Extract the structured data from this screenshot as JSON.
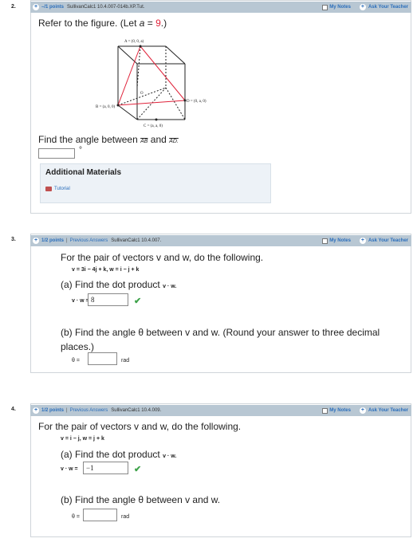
{
  "q2": {
    "num": "2.",
    "points": "–/1 points",
    "source": "SullivanCalc1 10.4.007-014b.XP.Tut.",
    "my_notes": "My Notes",
    "ask": "Ask Your Teacher",
    "intro_prefix": "Refer to the figure. (Let ",
    "intro_var": "a",
    "intro_eq": " = ",
    "intro_val": "9",
    "intro_suffix": ".)",
    "fig": {
      "A": "A = (0, 0, a)",
      "B": "B = (a, 0, 0)",
      "C": "C = (a, a, 0)",
      "D": "D = (0, a, 0)",
      "O": "O"
    },
    "question_prefix": "Find the angle between",
    "vec1": "AB",
    "and": "and",
    "vec2": "AD.",
    "degree": "°",
    "additional": "Additional Materials",
    "tutorial": "Tutorial"
  },
  "q3": {
    "num": "3.",
    "points": "1/2 points",
    "prev": "Previous Answers",
    "source": "SullivanCalc1 10.4.007.",
    "my_notes": "My Notes",
    "ask": "Ask Your Teacher",
    "intro": "For the pair of vectors v and w, do the following.",
    "vectors": "v = 3i − 4j + k,   w = i − j + k",
    "part_a": "(a) Find the dot product",
    "dot_label": "v · w.",
    "vw_label": "v · w =",
    "answer_a": "8",
    "part_b": "(b) Find the angle θ between v and w. (Round your answer to three decimal places.)",
    "theta_label": "θ =",
    "unit": "rad"
  },
  "q4": {
    "num": "4.",
    "points": "1/2 points",
    "prev": "Previous Answers",
    "source": "SullivanCalc1 10.4.009.",
    "my_notes": "My Notes",
    "ask": "Ask Your Teacher",
    "intro": "For the pair of vectors v and w, do the following.",
    "vectors": "v = i − j,   w = j + k",
    "part_a": "(a) Find the dot product",
    "dot_label": "v · w.",
    "vw_label": "v · w =",
    "answer_a": "−1",
    "part_b": "(b) Find the angle θ between v and w.",
    "theta_label": "θ =",
    "unit": "rad"
  }
}
